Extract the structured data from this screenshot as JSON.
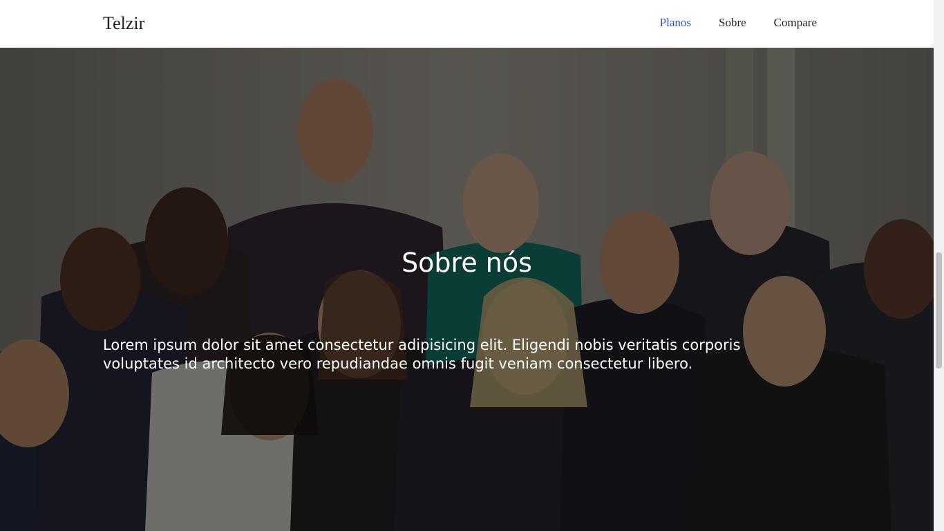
{
  "navbar": {
    "brand": "Telzir",
    "links": [
      {
        "label": "Planos",
        "active": true
      },
      {
        "label": "Sobre",
        "active": false
      },
      {
        "label": "Compare",
        "active": false
      }
    ],
    "active_color": "#2f56b4"
  },
  "hero": {
    "image": "group-of-business-people-photo",
    "title": "Sobre nós",
    "text": "Lorem ipsum dolor sit amet consectetur adipisicing elit. Eligendi nobis veritatis corporis voluptates id architecto vero repudiandae omnis fugit veniam consectetur libero."
  }
}
